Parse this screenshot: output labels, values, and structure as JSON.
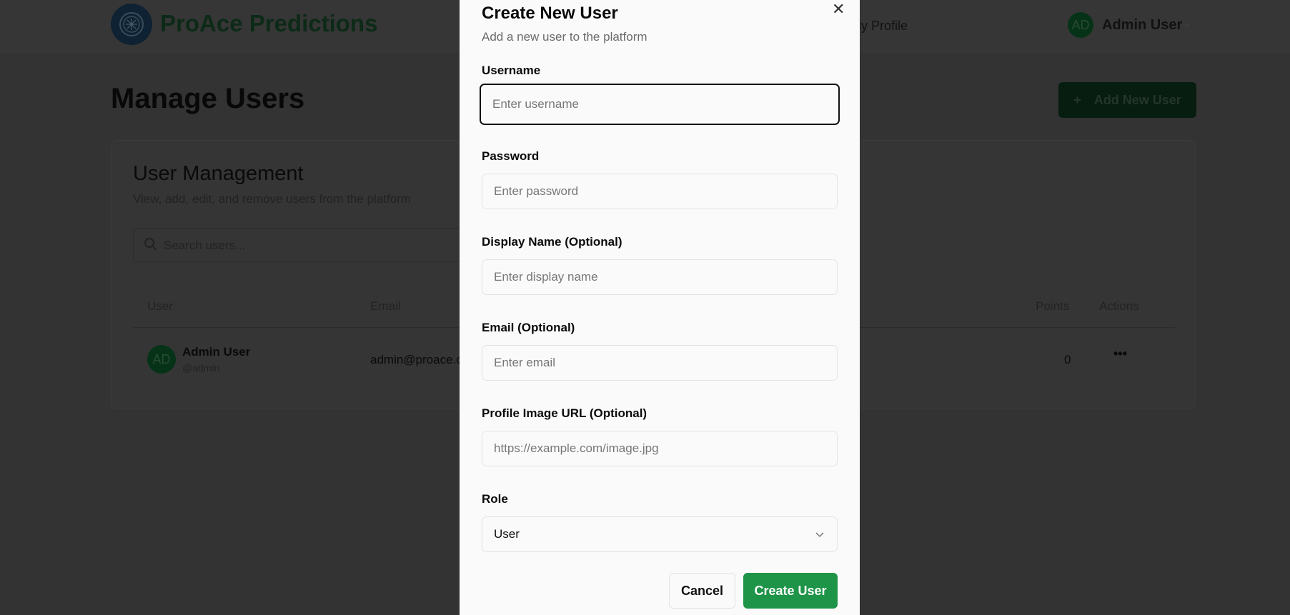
{
  "header": {
    "brand": "ProAce Predictions",
    "nav_my_profile": "My Profile",
    "user_initials": "AD",
    "user_name": "Admin User"
  },
  "page": {
    "title": "Manage Users",
    "add_button": "Add New User"
  },
  "card": {
    "title": "User Management",
    "subtitle": "View, add, edit, and remove users from the platform",
    "search_placeholder": "Search users...",
    "columns": {
      "user": "User",
      "email": "Email",
      "points": "Points",
      "actions": "Actions"
    },
    "rows": [
      {
        "initials": "AD",
        "name": "Admin User",
        "handle": "@admin",
        "email": "admin@proace.c",
        "points": "0",
        "actions": "•••"
      }
    ]
  },
  "modal": {
    "title": "Create New User",
    "subtitle": "Add a new user to the platform",
    "fields": [
      {
        "label": "Username",
        "placeholder": "Enter username",
        "value": ""
      },
      {
        "label": "Password",
        "placeholder": "Enter password",
        "value": ""
      },
      {
        "label": "Display Name (Optional)",
        "placeholder": "Enter display name",
        "value": ""
      },
      {
        "label": "Email (Optional)",
        "placeholder": "Enter email",
        "value": ""
      },
      {
        "label": "Profile Image URL (Optional)",
        "placeholder": "https://example.com/image.jpg",
        "value": ""
      }
    ],
    "role_label": "Role",
    "role_value": "User",
    "cancel": "Cancel",
    "create": "Create User"
  },
  "colors": {
    "accent": "#1e9448",
    "overlay": "#333333"
  }
}
